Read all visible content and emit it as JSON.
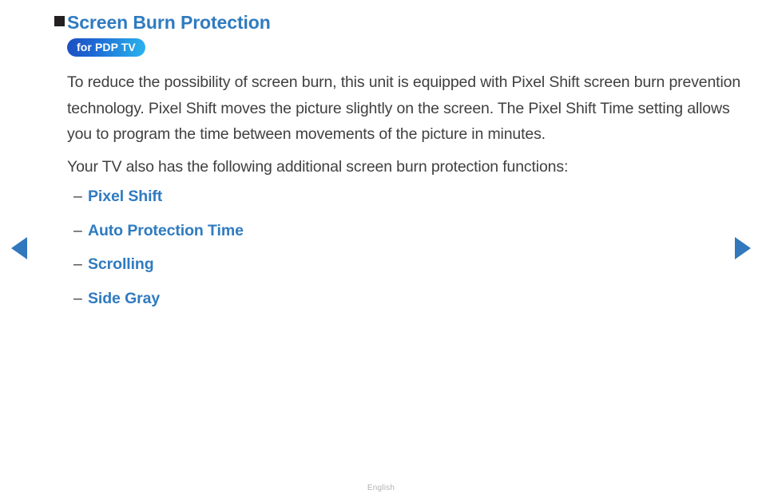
{
  "page": {
    "heading": "Screen Burn Protection",
    "badge": "for PDP TV",
    "paragraphs": [
      "To reduce the possibility of screen burn, this unit is equipped with Pixel Shift screen burn prevention technology. Pixel Shift moves the picture slightly on the screen. The Pixel Shift Time setting allows you to program the time between movements of the picture in minutes.",
      "Your TV also has the following additional screen burn protection functions:"
    ],
    "list": {
      "dash": "–",
      "items": [
        {
          "label": "Pixel Shift"
        },
        {
          "label": "Auto Protection Time"
        },
        {
          "label": "Scrolling"
        },
        {
          "label": "Side Gray"
        }
      ]
    },
    "footer": "English",
    "nav": {
      "prev_label": "Previous page",
      "next_label": "Next page"
    },
    "colors": {
      "heading_blue": "#2f7bc0",
      "link_blue": "#2f7bc0",
      "body_text": "#404040",
      "bullet_square": "#231f20",
      "badge_gradient_start": "#1b4fc0",
      "badge_gradient_end": "#2cb3ef",
      "arrow_blue": "#3178bd",
      "footer_gray": "#b3b3b3",
      "background": "#ffffff"
    }
  }
}
